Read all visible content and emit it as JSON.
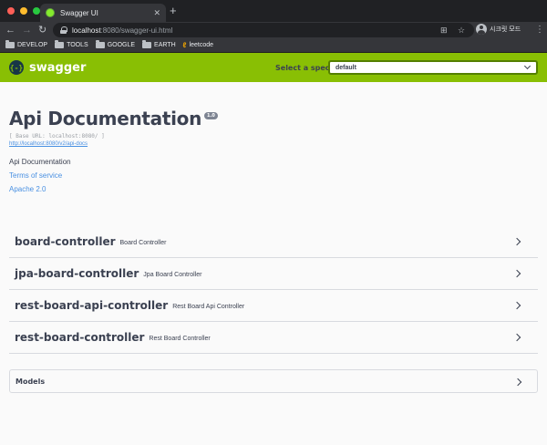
{
  "browser": {
    "tab_title": "Swagger UI",
    "tab_close": "✕",
    "new_tab": "+",
    "url_host": "localhost",
    "url_path": ":8080/swagger-ui.html",
    "profile_label": "시크릿 모드",
    "traffic_colors": [
      "#ff5f57",
      "#febc2e",
      "#28c840"
    ],
    "bookmarks": [
      "DEVELOP",
      "TOOLS",
      "GOOGLE",
      "EARTH",
      "leetcode"
    ]
  },
  "swagger": {
    "logo_text": "swagger",
    "logo_mark": "{-}",
    "spec_label": "Select a spec",
    "spec_value": "default",
    "brand_color": "#89bf04"
  },
  "info": {
    "title": "Api Documentation",
    "version": "1.0",
    "base_url": "[ Base URL: localhost:8080/ ]",
    "api_docs_url": "http://localhost:8080/v2/api-docs",
    "description": "Api Documentation",
    "terms_link": "Terms of service",
    "license_link": "Apache 2.0"
  },
  "controllers": [
    {
      "name": "board-controller",
      "description": "Board Controller"
    },
    {
      "name": "jpa-board-controller",
      "description": "Jpa Board Controller"
    },
    {
      "name": "rest-board-api-controller",
      "description": "Rest Board Api Controller"
    },
    {
      "name": "rest-board-controller",
      "description": "Rest Board Controller"
    }
  ],
  "models_label": "Models"
}
